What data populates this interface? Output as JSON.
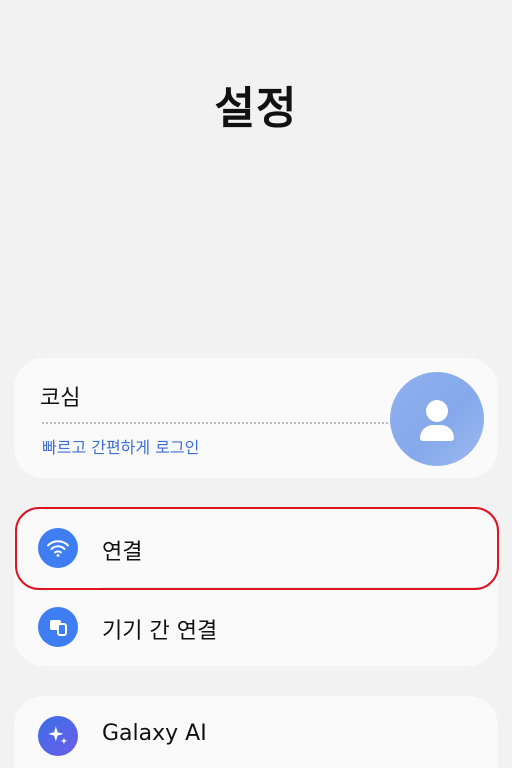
{
  "page": {
    "title": "설정"
  },
  "account": {
    "name": "코심",
    "login_link": "빠르고 간편하게 로그인"
  },
  "connections": {
    "items": [
      {
        "label": "연결",
        "icon": "wifi-icon",
        "highlighted": true
      },
      {
        "label": "기기 간 연결",
        "icon": "devices-icon"
      }
    ]
  },
  "galaxy_ai": {
    "label": "Galaxy AI",
    "icon": "sparkle-icon"
  },
  "colors": {
    "background": "#f2f2f2",
    "card": "#fafafa",
    "accent_blue": "#3f7ef2",
    "link_blue": "#3d6fd6",
    "highlight_red": "#e0141e",
    "avatar": "#8fb0ee"
  }
}
